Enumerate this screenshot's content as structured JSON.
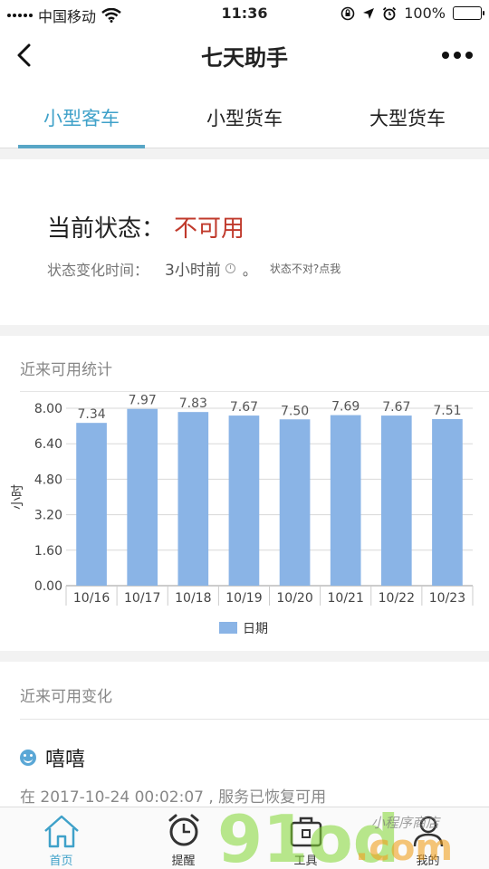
{
  "statusbar": {
    "carrier": "中国移动",
    "time": "11:36",
    "battery": "100%"
  },
  "nav": {
    "title": "七天助手"
  },
  "tabs": [
    {
      "label": "小型客车",
      "active": true
    },
    {
      "label": "小型货车",
      "active": false
    },
    {
      "label": "大型货车",
      "active": false
    }
  ],
  "status": {
    "label": "当前状态：",
    "value": "不可用",
    "change_label": "状态变化时间：",
    "change_value": "3小时前",
    "dot": "。",
    "report_link": "状态不对?点我"
  },
  "stats": {
    "title": "近来可用统计"
  },
  "chart_data": {
    "type": "bar",
    "categories": [
      "10/16",
      "10/17",
      "10/18",
      "10/19",
      "10/20",
      "10/21",
      "10/22",
      "10/23"
    ],
    "series": [
      {
        "name": "日期",
        "values": [
          7.34,
          7.97,
          7.83,
          7.67,
          7.5,
          7.69,
          7.67,
          7.51
        ],
        "color": "#8ab4e6"
      }
    ],
    "ylabel": "小时",
    "xlabel": "",
    "ylim": [
      0,
      8
    ],
    "yticks": [
      "0.00",
      "1.60",
      "3.20",
      "4.80",
      "6.40",
      "8.00"
    ],
    "grid": true,
    "legend": "bottom-center"
  },
  "changes": {
    "title": "近来可用变化",
    "entry": {
      "name": "嘻嘻",
      "text": "在 2017-10-24 00:02:07 , 服务已恢复可用"
    }
  },
  "tabbar": [
    {
      "label": "首页",
      "icon": "home-icon",
      "active": true
    },
    {
      "label": "提醒",
      "icon": "alarm-clock-icon",
      "active": false
    },
    {
      "label": "工具",
      "icon": "toolbox-icon",
      "active": false
    },
    {
      "label": "我的",
      "icon": "user-icon",
      "active": false
    }
  ],
  "watermark": {
    "text": "91od",
    "suffix": ".com",
    "tagline": "小程序商店"
  },
  "colors": {
    "accent": "#3fa1c9",
    "alert": "#c0392b",
    "bar": "#8ab4e6"
  }
}
